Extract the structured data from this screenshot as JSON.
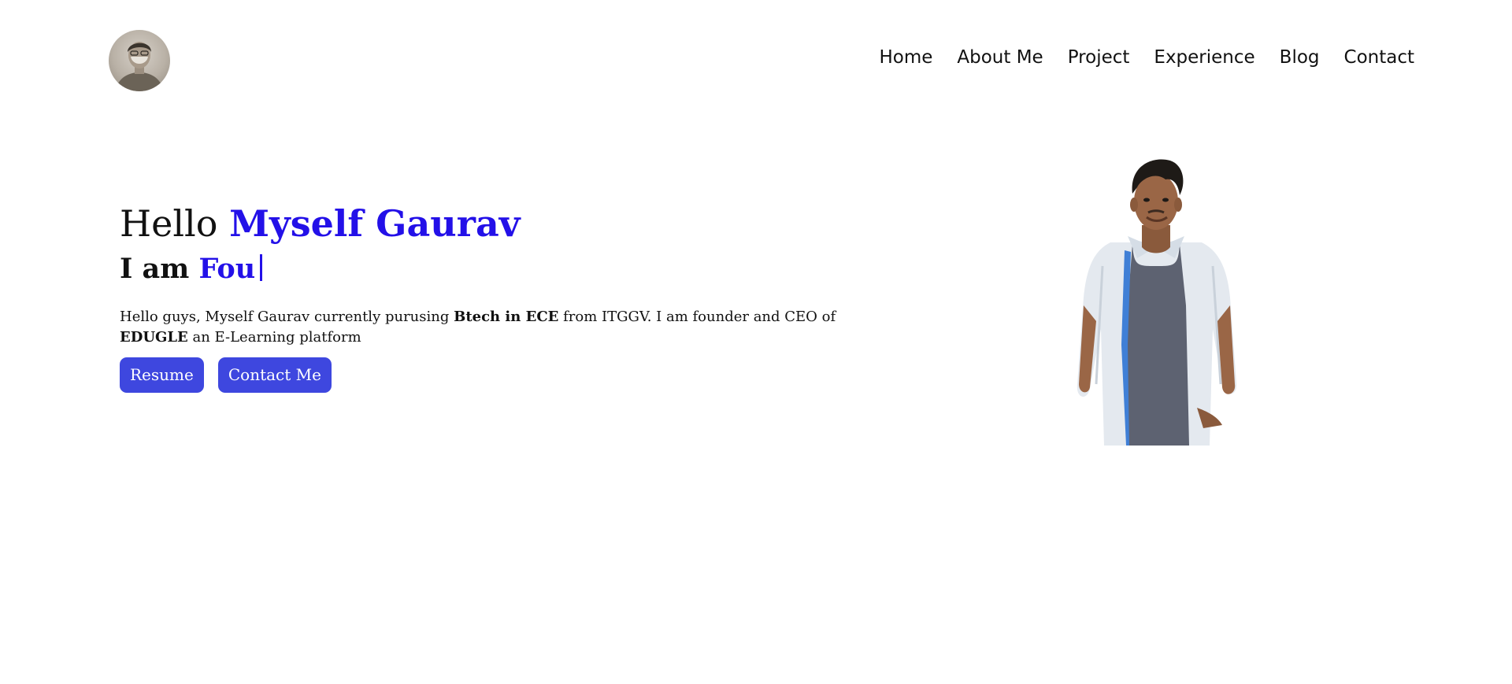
{
  "header": {
    "avatar_icon": "profile-avatar",
    "nav": [
      {
        "label": "Home"
      },
      {
        "label": "About Me"
      },
      {
        "label": "Project"
      },
      {
        "label": "Experience"
      },
      {
        "label": "Blog"
      },
      {
        "label": "Contact"
      }
    ]
  },
  "hero": {
    "greeting": "Hello",
    "name": "Myself Gaurav",
    "subtitle_prefix": "I am",
    "typed_text": "Fou",
    "intro": {
      "part1": "Hello guys, Myself Gaurav currently purusing ",
      "degree": "Btech in ECE",
      "part2": " from ITGGV. I am founder and CEO of ",
      "company": "EDUGLE",
      "part3": " an E-Learning platform"
    },
    "buttons": {
      "resume": "Resume",
      "contact": "Contact Me"
    }
  },
  "colors": {
    "accent": "#2310e8",
    "button": "#3e47df",
    "text": "#111111",
    "background": "#ffffff"
  }
}
